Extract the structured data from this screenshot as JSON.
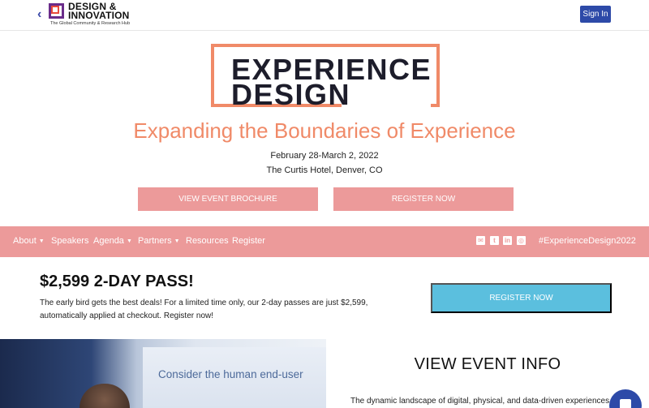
{
  "header": {
    "back_glyph": "‹",
    "logo_title_line1": "DESIGN &",
    "logo_title_line2": "INNOVATION",
    "logo_subtitle": "The Global Community & Research Hub",
    "sign_in_label": "Sign In",
    "colors": {
      "sign_in_bg": "#2d4aa8"
    }
  },
  "hero": {
    "logo_line1": "EXPERIENCE",
    "logo_line2": "DESIGN",
    "tagline": "Expanding the Boundaries of Experience",
    "dates": "February 28-March 2, 2022",
    "venue": "The Curtis Hotel, Denver, CO",
    "brochure_label": "VIEW EVENT BROCHURE",
    "register_label": "REGISTER NOW",
    "colors": {
      "accent": "#f08a68",
      "button": "#ec9a9a"
    }
  },
  "nav": {
    "items": [
      {
        "label": "About",
        "dropdown": true
      },
      {
        "label": "Speakers",
        "dropdown": false
      },
      {
        "label": "Agenda",
        "dropdown": true
      },
      {
        "label": "Partners",
        "dropdown": true
      },
      {
        "label": "Resources",
        "dropdown": false
      },
      {
        "label": "Register",
        "dropdown": false
      }
    ],
    "caret_glyph": "▼",
    "social": [
      {
        "icon": "email-icon",
        "glyph": "✉"
      },
      {
        "icon": "twitter-icon",
        "glyph": "t"
      },
      {
        "icon": "linkedin-icon",
        "glyph": "in"
      },
      {
        "icon": "instagram-icon",
        "glyph": "◎"
      }
    ],
    "hashtag": "#ExperienceDesign2022",
    "colors": {
      "background": "#ec9a9a"
    }
  },
  "promo": {
    "title": "$2,599 2-DAY PASS!",
    "text": "The early bird gets the best deals! For a limited time only, our 2-day passes are just $2,599, automatically applied at checkout. Register now!",
    "register_label": "REGISTER NOW",
    "colors": {
      "button": "#5bbfde"
    }
  },
  "info": {
    "photo_caption": "Consider the human end-user",
    "title": "VIEW EVENT INFO",
    "text": "The dynamic landscape of digital, physical, and data-driven experiences"
  },
  "chat": {
    "icon": "chat-icon",
    "colors": {
      "background": "#2d4aa8"
    }
  }
}
